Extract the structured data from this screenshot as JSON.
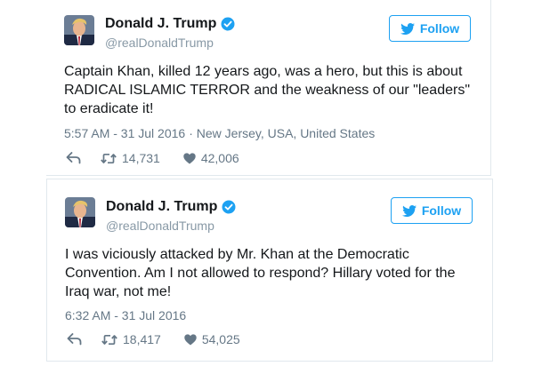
{
  "tweets": [
    {
      "name": "Donald J. Trump",
      "handle": "@realDonaldTrump",
      "follow_label": "Follow",
      "text": "Captain Khan, killed 12 years ago, was a hero, but this is about RADICAL ISLAMIC TERROR and the weakness of our \"leaders\" to eradicate it!",
      "timestamp": "5:57 AM - 31 Jul 2016",
      "location": "· New Jersey, USA, United States",
      "retweets": "14,731",
      "likes": "42,006"
    },
    {
      "name": "Donald J. Trump",
      "handle": "@realDonaldTrump",
      "follow_label": "Follow",
      "text": "I was viciously attacked by Mr. Khan at the Democratic Convention. Am I not allowed to respond? Hillary voted for the Iraq war, not me!",
      "timestamp": "6:32 AM - 31 Jul 2016",
      "location": "",
      "retweets": "18,417",
      "likes": "54,025"
    }
  ],
  "icons": {
    "verified": "verified-badge-icon",
    "bird": "twitter-bird-icon",
    "reply": "reply-icon",
    "retweet": "retweet-icon",
    "like": "heart-icon"
  },
  "colors": {
    "accent": "#1da1f2",
    "name": "#14171a",
    "secondary": "#657786",
    "border": "#e1e8ed"
  }
}
